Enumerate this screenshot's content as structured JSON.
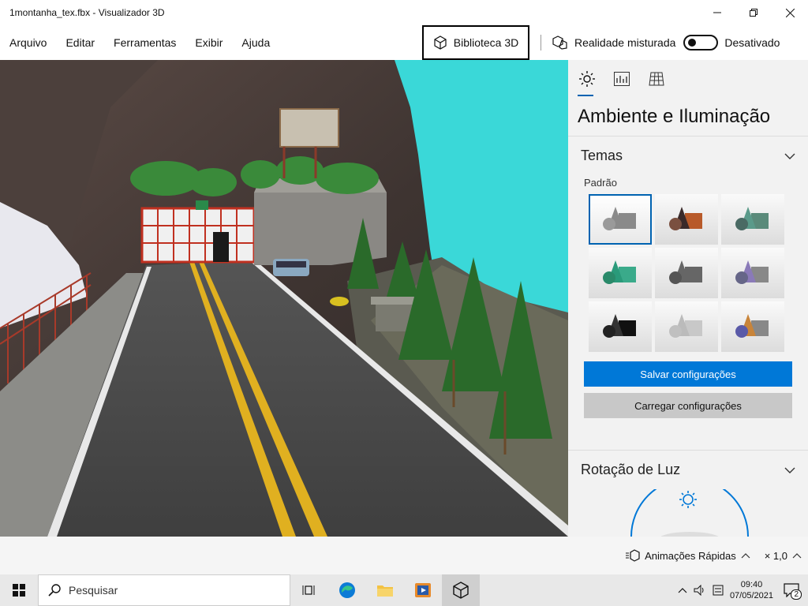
{
  "window": {
    "title": "1montanha_tex.fbx - Visualizador 3D",
    "minimize_icon": "minimize-icon",
    "maximize_icon": "restore-icon",
    "close_icon": "close-icon"
  },
  "menubar": {
    "items": [
      "Arquivo",
      "Editar",
      "Ferramentas",
      "Exibir",
      "Ajuda"
    ],
    "library_button": "Biblioteca 3D",
    "mixed_reality_label": "Realidade misturada",
    "mixed_reality_state": "Desativado"
  },
  "panel": {
    "tabs": [
      "sun-icon",
      "stats-icon",
      "grid-icon"
    ],
    "title": "Ambiente e Iluminação",
    "themes_section": "Temas",
    "theme_group_label": "Padrão",
    "themes": [
      {
        "cone": "#8a8a8a",
        "box": "#8a8a8a",
        "sphere": "#9a9a9a"
      },
      {
        "cone": "#3a2a2a",
        "box": "#b85a2a",
        "sphere": "#7a5040"
      },
      {
        "cone": "#5a9a8a",
        "box": "#5a8a7a",
        "sphere": "#4a6a64"
      },
      {
        "cone": "#2a9a7a",
        "box": "#3aaa8a",
        "sphere": "#2a8a6a"
      },
      {
        "cone": "#666666",
        "box": "#666666",
        "sphere": "#555555"
      },
      {
        "cone": "#8a7ab8",
        "box": "#888888",
        "sphere": "#666688"
      },
      {
        "cone": "#333333",
        "box": "#111111",
        "sphere": "#222222"
      },
      {
        "cone": "#bbbbbb",
        "box": "#c8c8c8",
        "sphere": "#c0c0c0"
      },
      {
        "cone": "#c8843a",
        "box": "#888888",
        "sphere": "#5a5aa8"
      }
    ],
    "save_button": "Salvar configurações",
    "load_button": "Carregar configurações",
    "light_rotation_section": "Rotação de Luz"
  },
  "statusbar": {
    "animations_label": "Animações Rápidas",
    "speed_label": "× 1,0"
  },
  "taskbar": {
    "search_placeholder": "Pesquisar",
    "time": "09:40",
    "date": "07/05/2021",
    "notifications_count": "2"
  },
  "colors": {
    "accent": "#0078d7",
    "selection_border": "#0063b1",
    "sky": "#3ad8d8",
    "road": "#4a4a4a",
    "yellow_line": "#e0b020"
  }
}
